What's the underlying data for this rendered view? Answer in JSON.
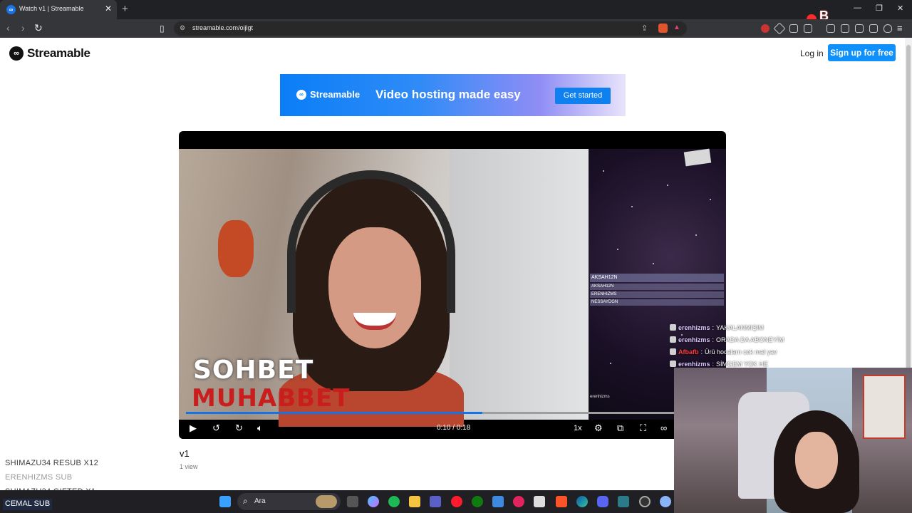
{
  "browser": {
    "tab_title": "Watch v1 | Streamable",
    "tab_favicon": "∞",
    "url": "streamable.com/oijlgt",
    "colors": {
      "chrome_bg": "#202124",
      "toolbar_bg": "#35363a"
    }
  },
  "site": {
    "logo_text": "Streamable",
    "login_label": "Log in",
    "signup_label": "Sign up for free",
    "banner": {
      "logo_text": "Streamable",
      "tagline": "Video hosting made easy",
      "cta": "Get started"
    }
  },
  "video": {
    "overlay_line1": "SOHBET",
    "overlay_line2": "MUHABBET",
    "time": "0:10 / 0:18",
    "progress_fraction": 0.556,
    "speed": "1x",
    "title": "v1",
    "views": "1 view",
    "leaderboard": [
      "AKSAH12N",
      "AKSAH12N",
      "ERENHIZMS",
      "NESSAYDGN"
    ],
    "in_stream_chat": "erenhizms"
  },
  "chat_overlay": [
    {
      "user": "erenhizms",
      "message": "YAKALANMIŞIM",
      "red": false
    },
    {
      "user": "erenhizms",
      "message": "ORADA DA ABONEYİM",
      "red": false
    },
    {
      "user": "Afbafb",
      "message": "Ürü hocalarn cok mal yav",
      "red": true
    },
    {
      "user": "erenhizms",
      "message": "SİMGEM YOK HE",
      "red": false
    }
  ],
  "alerts": [
    {
      "text": "SHIMAZU34   RESUB X12",
      "faded": false
    },
    {
      "text": "ERENHIZMS   SUB",
      "faded": true
    },
    {
      "text": "SHIMAZU34   GIFTED X1",
      "faded": false
    }
  ],
  "alert_current": "CEMAL  SUB",
  "taskbar": {
    "search_placeholder": "Ara",
    "icons": [
      "windows-start-icon",
      "task-view-icon",
      "copilot-icon",
      "spotify-icon",
      "file-explorer-icon",
      "teams-icon",
      "opera-icon",
      "xbox-icon",
      "store-icon",
      "media-player-icon",
      "snip-icon",
      "brave-icon",
      "edge-icon",
      "discord-icon",
      "terminal-icon",
      "obs-icon",
      "settings-icon"
    ]
  }
}
